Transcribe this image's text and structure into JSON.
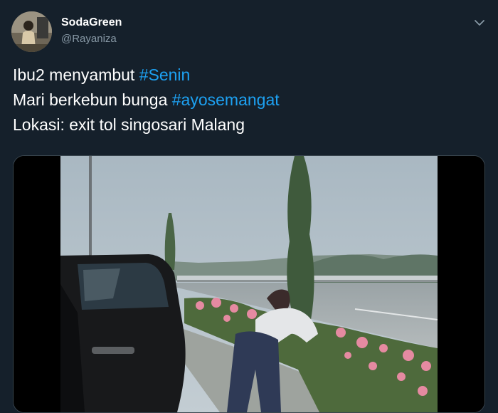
{
  "author": {
    "display_name": "SodaGreen",
    "handle": "@Rayaniza",
    "avatar_icon": "avatar-photo"
  },
  "menu": {
    "icon": "chevron-down-icon"
  },
  "tweet": {
    "line1_text": "Ibu2 menyambut ",
    "line1_hashtag": "#Senin",
    "line2_text": "Mari berkebun bunga ",
    "line2_hashtag": "#ayosemangat",
    "line3_text": "Lokasi: exit tol singosari Malang"
  },
  "media": {
    "kind": "video",
    "icon": "video-thumbnail"
  },
  "colors": {
    "background": "#15202b",
    "text": "#ffffff",
    "secondary": "#8899a6",
    "link": "#1da1f2",
    "border": "#38444d"
  }
}
